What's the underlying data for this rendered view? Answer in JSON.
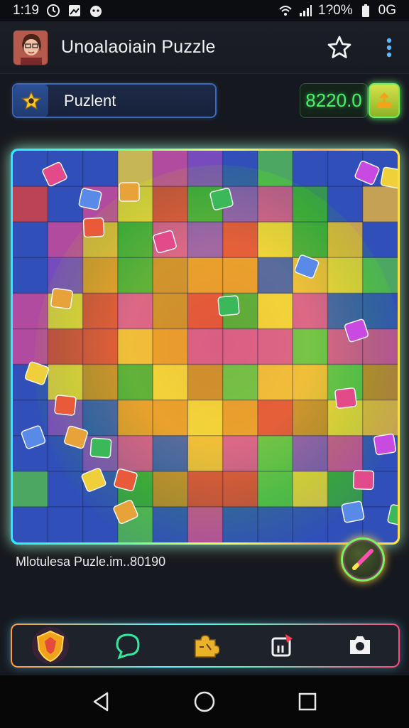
{
  "status_bar": {
    "time": "1:19",
    "battery_text": "1?0%",
    "network_text": "0G"
  },
  "app_bar": {
    "title": "Unoalaoiain Puzzle"
  },
  "title_pill": {
    "label": "Puzlent"
  },
  "score": {
    "value": "8220.0"
  },
  "board": {
    "rows": 11,
    "cols": 11
  },
  "file_label": "Mlotulesa Puzle.im..80190",
  "colors": {
    "accent_green": "#48f06a",
    "board_blue": "#3150b8",
    "glow_cyan": "#33e8ff"
  }
}
